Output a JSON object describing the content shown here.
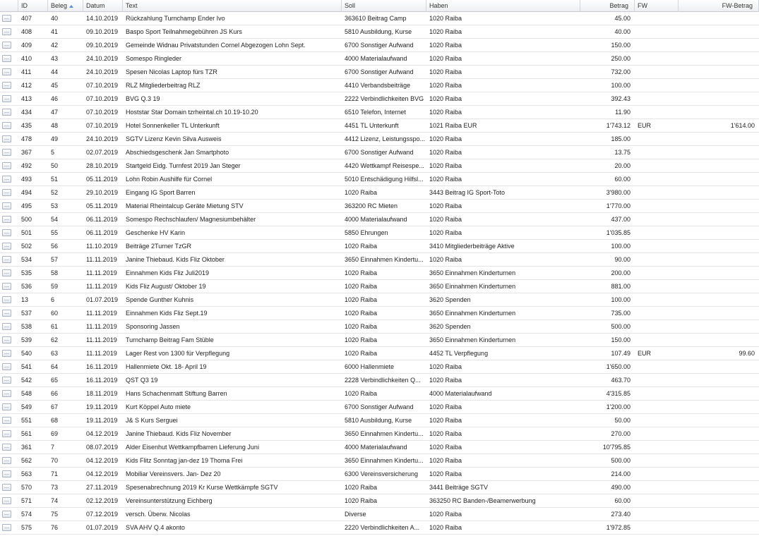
{
  "columns": {
    "icon": "",
    "id": "ID",
    "beleg": "Beleg",
    "datum": "Datum",
    "text": "Text",
    "soll": "Soll",
    "haben": "Haben",
    "betrag": "Betrag",
    "fw": "FW",
    "fw_betrag": "FW-Betrag",
    "sorted_column": "beleg",
    "sort_direction": "ascending"
  },
  "rows": [
    {
      "id": "407",
      "beleg": "40",
      "datum": "14.10.2019",
      "text": "Rückzahlung Turnchamp Ender Ivo",
      "soll": "363610 Beitrag Camp",
      "haben": "1020 Raiba",
      "betrag": "45.00",
      "fw": "",
      "fw_betrag": ""
    },
    {
      "id": "408",
      "beleg": "41",
      "datum": "09.10.2019",
      "text": "Baspo Sport Teilnahmegebühren JS Kurs",
      "soll": "5810 Ausbildung, Kurse",
      "haben": "1020 Raiba",
      "betrag": "40.00",
      "fw": "",
      "fw_betrag": ""
    },
    {
      "id": "409",
      "beleg": "42",
      "datum": "09.10.2019",
      "text": "Gemeinde Widnau Privatstunden Cornel Abgezogen Lohn Sept.",
      "soll": "6700 Sonstiger Aufwand",
      "haben": "1020 Raiba",
      "betrag": "150.00",
      "fw": "",
      "fw_betrag": ""
    },
    {
      "id": "410",
      "beleg": "43",
      "datum": "24.10.2019",
      "text": "Somespo Ringleder",
      "soll": "4000 Materialaufwand",
      "haben": "1020 Raiba",
      "betrag": "250.00",
      "fw": "",
      "fw_betrag": ""
    },
    {
      "id": "411",
      "beleg": "44",
      "datum": "24.10.2019",
      "text": "Spesen Nicolas Laptop fürs TZR",
      "soll": "6700 Sonstiger Aufwand",
      "haben": "1020 Raiba",
      "betrag": "732.00",
      "fw": "",
      "fw_betrag": ""
    },
    {
      "id": "412",
      "beleg": "45",
      "datum": "07.10.2019",
      "text": "RLZ Mitgliederbeitrag RLZ",
      "soll": "4410 Verbandsbeiträge",
      "haben": "1020 Raiba",
      "betrag": "100.00",
      "fw": "",
      "fw_betrag": ""
    },
    {
      "id": "413",
      "beleg": "46",
      "datum": "07.10.2019",
      "text": "BVG Q.3 19",
      "soll": "2222 Verbindlichkeiten BVG",
      "haben": "1020 Raiba",
      "betrag": "392.43",
      "fw": "",
      "fw_betrag": ""
    },
    {
      "id": "434",
      "beleg": "47",
      "datum": "07.10.2019",
      "text": "Hoststar Star Domain tzrheintal.ch 10.19-10.20",
      "soll": "6510 Telefon, Internet",
      "haben": "1020 Raiba",
      "betrag": "11.90",
      "fw": "",
      "fw_betrag": ""
    },
    {
      "id": "435",
      "beleg": "48",
      "datum": "07.10.2019",
      "text": "Hotel Sonnenkeller TL Unterkunft",
      "soll": "4451 TL Unterkunft",
      "haben": "1021 Raiba EUR",
      "betrag": "1'743.12",
      "fw": "EUR",
      "fw_betrag": "1'614.00"
    },
    {
      "id": "478",
      "beleg": "49",
      "datum": "24.10.2019",
      "text": "SGTV Lizenz Kevin Silva Ausweis",
      "soll": "4412 Lizenz, Leistungsspo...",
      "haben": "1020 Raiba",
      "betrag": "185.00",
      "fw": "",
      "fw_betrag": ""
    },
    {
      "id": "367",
      "beleg": "5",
      "datum": "02.07.2019",
      "text": "Abschiedsgeschenk Jan Smartphoto",
      "soll": "6700 Sonstiger Aufwand",
      "haben": "1020 Raiba",
      "betrag": "13.75",
      "fw": "",
      "fw_betrag": ""
    },
    {
      "id": "492",
      "beleg": "50",
      "datum": "28.10.2019",
      "text": "Startgeld Eidg. Turnfest 2019 Jan Steger",
      "soll": "4420 Wettkampf Reisespe...",
      "haben": "1020 Raiba",
      "betrag": "20.00",
      "fw": "",
      "fw_betrag": ""
    },
    {
      "id": "493",
      "beleg": "51",
      "datum": "05.11.2019",
      "text": "Lohn Robin Aushilfe für Cornel",
      "soll": "5010 Entschädigung Hilfsl...",
      "haben": "1020 Raiba",
      "betrag": "60.00",
      "fw": "",
      "fw_betrag": ""
    },
    {
      "id": "494",
      "beleg": "52",
      "datum": "29.10.2019",
      "text": "Eingang IG Sport Barren",
      "soll": "1020 Raiba",
      "haben": "3443 Beitrag IG Sport-Toto",
      "betrag": "3'980.00",
      "fw": "",
      "fw_betrag": ""
    },
    {
      "id": "495",
      "beleg": "53",
      "datum": "05.11.2019",
      "text": "Material Rheintalcup Geräte Mietung STV",
      "soll": "363200 RC Mieten",
      "haben": "1020 Raiba",
      "betrag": "1'770.00",
      "fw": "",
      "fw_betrag": ""
    },
    {
      "id": "500",
      "beleg": "54",
      "datum": "06.11.2019",
      "text": "Somespo Rechschlaufen/ Magnesiumbehälter",
      "soll": "4000 Materialaufwand",
      "haben": "1020 Raiba",
      "betrag": "437.00",
      "fw": "",
      "fw_betrag": ""
    },
    {
      "id": "501",
      "beleg": "55",
      "datum": "06.11.2019",
      "text": "Geschenke HV Karin",
      "soll": "5850 Ehrungen",
      "haben": "1020 Raiba",
      "betrag": "1'035.85",
      "fw": "",
      "fw_betrag": ""
    },
    {
      "id": "502",
      "beleg": "56",
      "datum": "11.10.2019",
      "text": "Beiträge 2Turner TzGR",
      "soll": "1020 Raiba",
      "haben": "3410 Mitgliederbeiträge Aktive",
      "betrag": "100.00",
      "fw": "",
      "fw_betrag": ""
    },
    {
      "id": "534",
      "beleg": "57",
      "datum": "11.11.2019",
      "text": "Janine Thiebaud. Kids Fliz Oktober",
      "soll": "3650 Einnahmen Kindertu...",
      "haben": "1020 Raiba",
      "betrag": "90.00",
      "fw": "",
      "fw_betrag": ""
    },
    {
      "id": "535",
      "beleg": "58",
      "datum": "11.11.2019",
      "text": "Einnahmen Kids Fliz Juli2019",
      "soll": "1020 Raiba",
      "haben": "3650 Einnahmen Kinderturnen",
      "betrag": "200.00",
      "fw": "",
      "fw_betrag": ""
    },
    {
      "id": "536",
      "beleg": "59",
      "datum": "11.11.2019",
      "text": "Kids Fliz August/ Oktober 19",
      "soll": "1020 Raiba",
      "haben": "3650 Einnahmen Kinderturnen",
      "betrag": "881.00",
      "fw": "",
      "fw_betrag": ""
    },
    {
      "id": "13",
      "beleg": "6",
      "datum": "01.07.2019",
      "text": "Spende Gunther Kuhnis",
      "soll": "1020 Raiba",
      "haben": "3620 Spenden",
      "betrag": "100.00",
      "fw": "",
      "fw_betrag": ""
    },
    {
      "id": "537",
      "beleg": "60",
      "datum": "11.11.2019",
      "text": "Einnahmen Kids Fliz Sept.19",
      "soll": "1020 Raiba",
      "haben": "3650 Einnahmen Kinderturnen",
      "betrag": "735.00",
      "fw": "",
      "fw_betrag": ""
    },
    {
      "id": "538",
      "beleg": "61",
      "datum": "11.11.2019",
      "text": "Sponsoring Jassen",
      "soll": "1020 Raiba",
      "haben": "3620 Spenden",
      "betrag": "500.00",
      "fw": "",
      "fw_betrag": ""
    },
    {
      "id": "539",
      "beleg": "62",
      "datum": "11.11.2019",
      "text": "Turnchamp Beitrag Fam Stüble",
      "soll": "1020 Raiba",
      "haben": "3650 Einnahmen Kinderturnen",
      "betrag": "150.00",
      "fw": "",
      "fw_betrag": ""
    },
    {
      "id": "540",
      "beleg": "63",
      "datum": "11.11.2019",
      "text": "Lager Rest von 1300 für Verpflegung",
      "soll": "1020 Raiba",
      "haben": "4452 TL Verpflegung",
      "betrag": "107.49",
      "fw": "EUR",
      "fw_betrag": "99.60"
    },
    {
      "id": "541",
      "beleg": "64",
      "datum": "16.11.2019",
      "text": "Hallenmiete Okt. 18- April 19",
      "soll": "6000 Hallenmiete",
      "haben": "1020 Raiba",
      "betrag": "1'650.00",
      "fw": "",
      "fw_betrag": ""
    },
    {
      "id": "542",
      "beleg": "65",
      "datum": "16.11.2019",
      "text": "QST Q3 19",
      "soll": "2228 Verbindlichkeiten Q...",
      "haben": "1020 Raiba",
      "betrag": "463.70",
      "fw": "",
      "fw_betrag": ""
    },
    {
      "id": "548",
      "beleg": "66",
      "datum": "18.11.2019",
      "text": "Hans Schachenmatt Stiftung Barren",
      "soll": "1020 Raiba",
      "haben": "4000 Materialaufwand",
      "betrag": "4'315.85",
      "fw": "",
      "fw_betrag": ""
    },
    {
      "id": "549",
      "beleg": "67",
      "datum": "19.11.2019",
      "text": "Kurt Köppel Auto miete",
      "soll": "6700 Sonstiger Aufwand",
      "haben": "1020 Raiba",
      "betrag": "1'200.00",
      "fw": "",
      "fw_betrag": ""
    },
    {
      "id": "551",
      "beleg": "68",
      "datum": "19.11.2019",
      "text": "J& S Kurs Serguei",
      "soll": "5810 Ausbildung, Kurse",
      "haben": "1020 Raiba",
      "betrag": "50.00",
      "fw": "",
      "fw_betrag": ""
    },
    {
      "id": "561",
      "beleg": "69",
      "datum": "04.12.2019",
      "text": "Janine Thiebaud. Kids Fliz November",
      "soll": "3650 Einnahmen Kindertu...",
      "haben": "1020 Raiba",
      "betrag": "270.00",
      "fw": "",
      "fw_betrag": ""
    },
    {
      "id": "361",
      "beleg": "7",
      "datum": "08.07.2019",
      "text": "Alder Eisenhut Wettkampfbarren Lieferung Juni",
      "soll": "4000 Materialaufwand",
      "haben": "1020 Raiba",
      "betrag": "10'795.85",
      "fw": "",
      "fw_betrag": ""
    },
    {
      "id": "562",
      "beleg": "70",
      "datum": "04.12.2019",
      "text": "Kids Flitz Sonntag jan-dez 19 Thoma Frei",
      "soll": "3650 Einnahmen Kindertu...",
      "haben": "1020 Raiba",
      "betrag": "500.00",
      "fw": "",
      "fw_betrag": ""
    },
    {
      "id": "563",
      "beleg": "71",
      "datum": "04.12.2019",
      "text": "Mobiliar Vereinsvers. Jan- Dez 20",
      "soll": "6300 Vereinsversicherung",
      "haben": "1020 Raiba",
      "betrag": "214.00",
      "fw": "",
      "fw_betrag": ""
    },
    {
      "id": "570",
      "beleg": "73",
      "datum": "27.11.2019",
      "text": "Spesenabrechnung 2019 Kr Kurse Wettkämpfe SGTV",
      "soll": "1020 Raiba",
      "haben": "3441 Beiträge SGTV",
      "betrag": "490.00",
      "fw": "",
      "fw_betrag": ""
    },
    {
      "id": "571",
      "beleg": "74",
      "datum": "02.12.2019",
      "text": "Vereinsunterstützung Eichberg",
      "soll": "1020 Raiba",
      "haben": "363250 RC Banden-/Beamerwerbung",
      "betrag": "60.00",
      "fw": "",
      "fw_betrag": ""
    },
    {
      "id": "574",
      "beleg": "75",
      "datum": "07.12.2019",
      "text": "versch. Überw. Nicolas",
      "soll": "Diverse",
      "haben": "1020 Raiba",
      "betrag": "273.40",
      "fw": "",
      "fw_betrag": ""
    },
    {
      "id": "575",
      "beleg": "76",
      "datum": "01.07.2019",
      "text": "SVA AHV Q.4 akonto",
      "soll": "2220 Verbindlichkeiten A...",
      "haben": "1020 Raiba",
      "betrag": "1'972.85",
      "fw": "",
      "fw_betrag": ""
    }
  ]
}
